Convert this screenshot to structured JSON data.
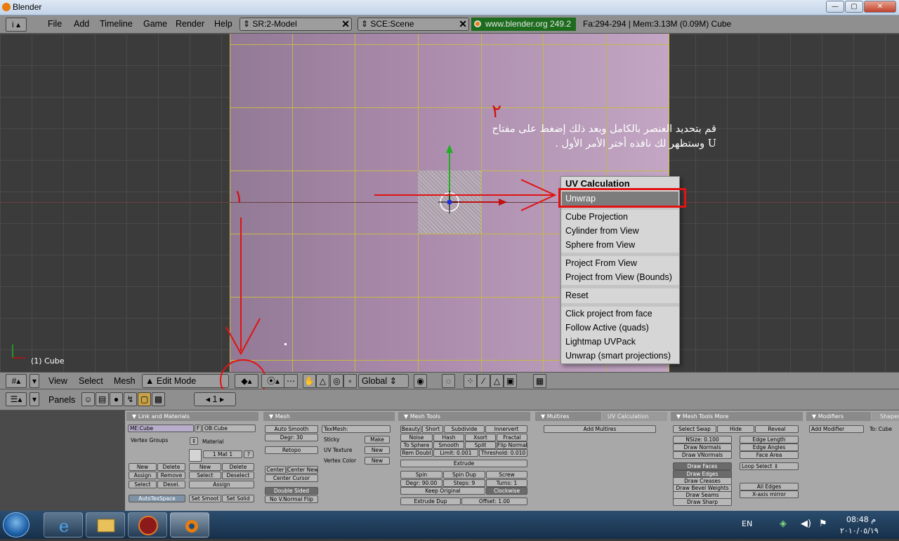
{
  "window": {
    "title": "Blender",
    "min": "—",
    "max": "▢",
    "close": "✕"
  },
  "top_header": {
    "info_icon": "i",
    "menus": [
      "File",
      "Add",
      "Timeline",
      "Game",
      "Render",
      "Help"
    ],
    "screen_select": "SR:2-Model",
    "scene_select": "SCE:Scene",
    "url": "www.blender.org 249.2",
    "stats": "Fa:294-294 | Mem:3.13M (0.09M) Cube"
  },
  "viewport": {
    "object_label": "(1) Cube",
    "arabic_note": "قم بتحديد العنصر بالكامل وبعد ذلك إضغط على مفتاح U وستظهر لك نافذه أختر الأمر الأول .",
    "step_one": "١",
    "step_two": "٢"
  },
  "uv_menu": {
    "title": "UV Calculation",
    "items": [
      "Unwrap",
      "Cube Projection",
      "Cylinder from View",
      "Sphere from View",
      "Project From View",
      "Project from View (Bounds)",
      "Reset",
      "Click project from face",
      "Follow Active (quads)",
      "Lightmap UVPack",
      "Unwrap (smart projections)"
    ]
  },
  "header_3d": {
    "menus": [
      "View",
      "Select",
      "Mesh"
    ],
    "mode": "Edit Mode",
    "orientation": "Global"
  },
  "buttons_header": {
    "panels_label": "Panels",
    "frame": "1"
  },
  "panels": {
    "link_materials": {
      "title": "Link and Materials",
      "me": "ME:Cube",
      "f": "F",
      "ob": "OB:Cube",
      "vertex_groups": "Vertex Groups",
      "material": "Material",
      "mat_slot": "1 Mat 1",
      "q": "?",
      "vg_buttons": [
        "New",
        "Delete",
        "Assign",
        "Remove",
        "Select",
        "Desel."
      ],
      "mat_buttons": [
        "New",
        "Delete",
        "Select",
        "Deselect",
        "Assign"
      ],
      "autotex": "AutoTexSpace",
      "set_smooth": "Set Smoot",
      "set_solid": "Set Solid"
    },
    "mesh": {
      "title": "Mesh",
      "auto_smooth": "Auto Smooth",
      "degr": "Degr: 30",
      "retopo": "Retopo",
      "texmesh": "TexMesh:",
      "sticky": "Sticky",
      "make": "Make",
      "uv_texture": "UV Texture",
      "vertex_color": "Vertex Color",
      "new": "New",
      "center": "Center",
      "center_new": "Center New",
      "center_cursor": "Center Cursor",
      "double_sided": "Double Sided",
      "no_vnormal_flip": "No V.Normal Flip"
    },
    "mesh_tools": {
      "title": "Mesh Tools",
      "row1": [
        "Beauty",
        "Short",
        "Subdivide",
        "Innervert"
      ],
      "row2": [
        "Noise",
        "Hash",
        "Xsort",
        "Fractal"
      ],
      "row3": [
        "To Sphere",
        "Smooth",
        "Split",
        "Flip Normal"
      ],
      "row4": [
        "Rem Doubl",
        "Limit: 0.001",
        "Threshold: 0.010"
      ],
      "extrude": "Extrude",
      "row5": [
        "Spin",
        "Spin Dup",
        "Screw"
      ],
      "row6": [
        "Degr: 90.00",
        "Steps: 9",
        "Turns: 1"
      ],
      "keep_original": "Keep Original",
      "clockwise": "Clockwise",
      "extrude_dup": "Extrude Dup",
      "offset": "Offset: 1.00"
    },
    "multires": {
      "tab1": "Multires",
      "tab2": "UV Calculation",
      "add": "Add Multires"
    },
    "mesh_tools_more": {
      "title": "Mesh Tools More",
      "row1": [
        "Select Swap",
        "Hide",
        "Reveal"
      ],
      "nsize": "NSize: 0.100",
      "left": [
        "Draw Normals",
        "Draw VNormals"
      ],
      "right": [
        "Edge Length",
        "Edge Angles",
        "Face Area"
      ],
      "draw": [
        "Draw Faces",
        "Draw Edges",
        "Draw Creases",
        "Draw Bevel Weights",
        "Draw Seams",
        "Draw Sharp"
      ],
      "loop_select": "Loop Select",
      "all_edges": "All Edges",
      "x_mirror": "X-axis mirror"
    },
    "modifiers": {
      "tab1": "Modifiers",
      "tab2": "Shapes",
      "add": "Add Modifier",
      "to": "To: Cube"
    }
  },
  "taskbar": {
    "lang": "EN",
    "time": "08:48 م",
    "date": "٢٠١٠/٠٥/١٩"
  }
}
